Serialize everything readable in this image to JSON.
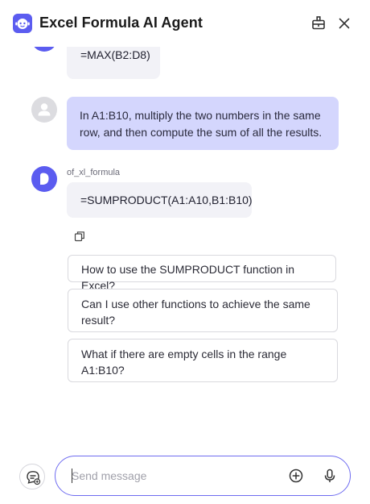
{
  "header": {
    "title": "Excel Formula AI Agent",
    "logo_icon": "robot-logo-icon",
    "pin_icon": "pin-window-icon",
    "close_icon": "close-icon"
  },
  "messages": [
    {
      "role": "bot",
      "text": "=MAX(B2:D8)"
    },
    {
      "role": "user",
      "text_line1": "In A1:B10, multiply the two numbers in the same",
      "text_line2": "row, and then compute the sum of all the results."
    },
    {
      "role": "bot",
      "sender": "of_xl_formula",
      "text": "=SUMPRODUCT(A1:A10,B1:B10)"
    }
  ],
  "suggestions": [
    {
      "line1": "How to use the SUMPRODUCT function in Excel?"
    },
    {
      "line1": "Can I use other functions to achieve the same",
      "line2": "result?"
    },
    {
      "line1": "What if there are empty cells in the range",
      "line2": "A1:B10?"
    }
  ],
  "composer": {
    "placeholder": "Send message",
    "value": ""
  },
  "colors": {
    "accent": "#5b5cf0",
    "user_bubble": "#d4d6fd",
    "bot_bubble": "#f2f2f7"
  }
}
